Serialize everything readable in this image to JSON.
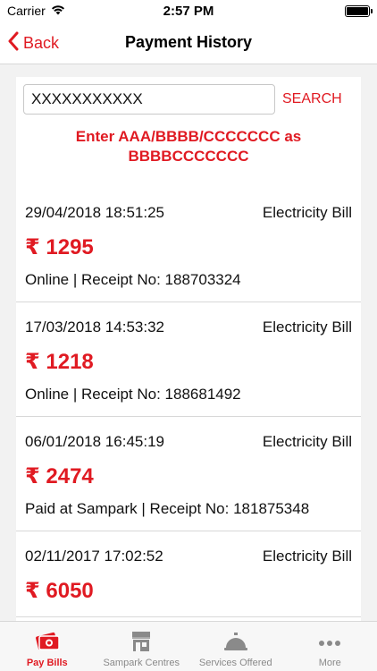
{
  "status": {
    "carrier": "Carrier",
    "time": "2:57 PM"
  },
  "nav": {
    "back_label": "Back",
    "title": "Payment History"
  },
  "search": {
    "value": "XXXXXXXXXXX",
    "button_label": "SEARCH"
  },
  "hint": "Enter AAA/BBBB/CCCCCCC as BBBBCCCCCCC",
  "payments": [
    {
      "datetime": "29/04/2018 18:51:25",
      "type": "Electricity Bill",
      "amount": "₹ 1295",
      "details": "Online | Receipt No: 188703324"
    },
    {
      "datetime": "17/03/2018 14:53:32",
      "type": "Electricity Bill",
      "amount": "₹ 1218",
      "details": "Online | Receipt No: 188681492"
    },
    {
      "datetime": "06/01/2018 16:45:19",
      "type": "Electricity Bill",
      "amount": "₹ 2474",
      "details": "Paid at Sampark | Receipt No: 181875348"
    },
    {
      "datetime": "02/11/2017 17:02:52",
      "type": "Electricity Bill",
      "amount": "₹ 6050",
      "details": ""
    }
  ],
  "tabs": [
    {
      "label": "Pay Bills",
      "icon": "cash-icon",
      "active": true
    },
    {
      "label": "Sampark Centres",
      "icon": "store-icon",
      "active": false
    },
    {
      "label": "Services Offered",
      "icon": "service-bell-icon",
      "active": false
    },
    {
      "label": "More",
      "icon": "more-dots-icon",
      "active": false
    }
  ],
  "colors": {
    "accent": "#e01a22",
    "inactive": "#8a8a8a"
  }
}
